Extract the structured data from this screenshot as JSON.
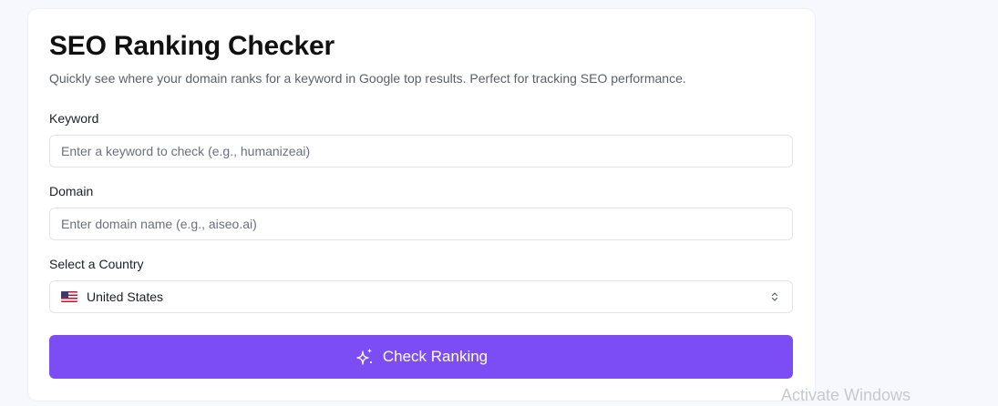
{
  "card": {
    "title": "SEO Ranking Checker",
    "subtitle": "Quickly see where your domain ranks for a keyword in Google top results. Perfect for tracking SEO performance."
  },
  "form": {
    "keyword": {
      "label": "Keyword",
      "placeholder": "Enter a keyword to check (e.g., humanizeai)",
      "value": ""
    },
    "domain": {
      "label": "Domain",
      "placeholder": "Enter domain name (e.g., aiseo.ai)",
      "value": ""
    },
    "country": {
      "label": "Select a Country",
      "selected": "United States",
      "flag_icon": "us-flag-icon"
    },
    "submit_label": "Check Ranking",
    "submit_icon": "sparkle-icon"
  },
  "colors": {
    "accent": "#7c4df5",
    "background": "#f7f8fd",
    "card": "#ffffff"
  },
  "watermark": "Activate Windows"
}
